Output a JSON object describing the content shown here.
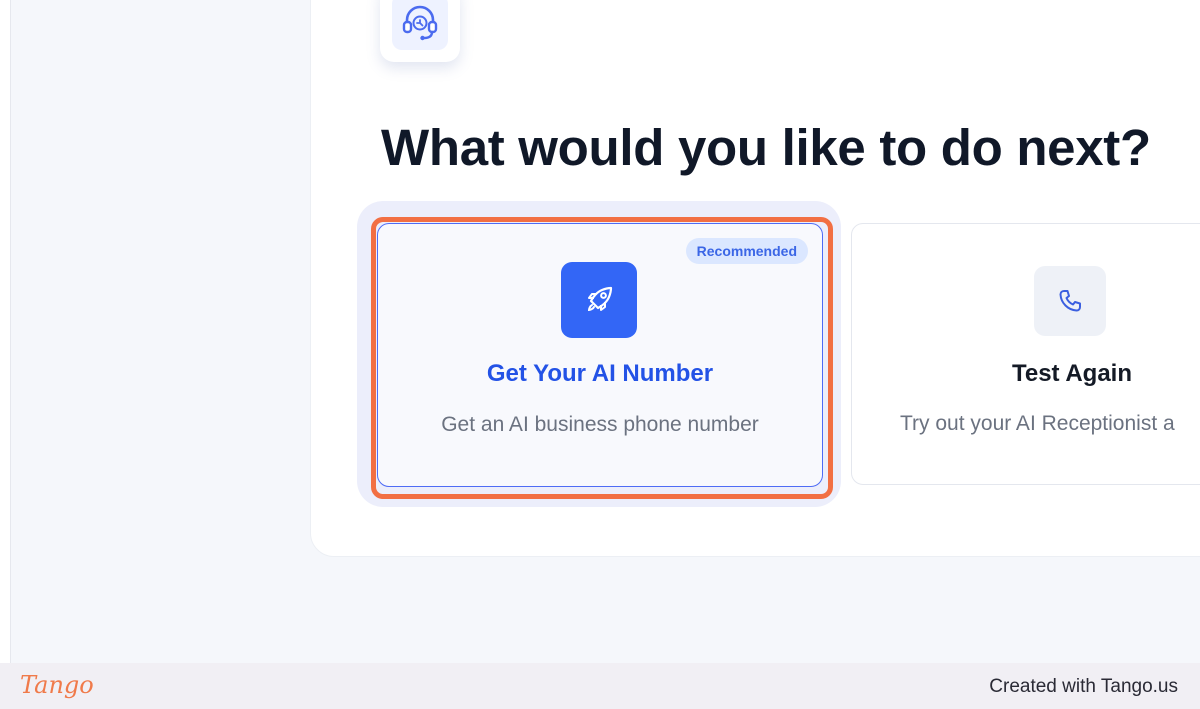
{
  "main": {
    "heading": "What would you like to do next?",
    "hero_icon": "headset-support-icon"
  },
  "options": [
    {
      "badge": "Recommended",
      "title": "Get Your AI Number",
      "description": "Get an AI business phone number",
      "icon": "rocket-icon",
      "selected": true,
      "accent": "#3366f6"
    },
    {
      "title": "Test Again",
      "description": "Try out your AI Receptionist a",
      "icon": "phone-icon",
      "selected": false
    }
  ],
  "footer": {
    "logo": "Tango",
    "credit": "Created with Tango.us"
  },
  "colors": {
    "highlight": "#f26f43",
    "accent": "#3366f6",
    "heading": "#101828"
  }
}
